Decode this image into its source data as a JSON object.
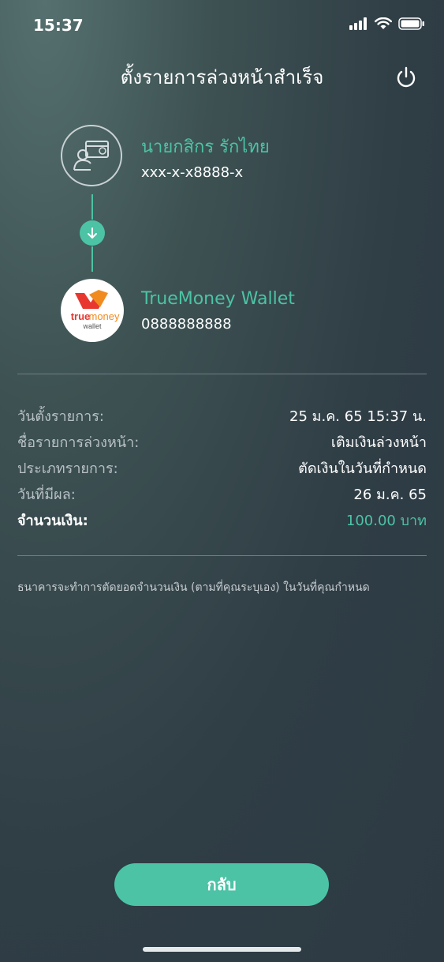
{
  "status": {
    "time": "15:37"
  },
  "header": {
    "title": "ตั้งรายการล่วงหน้าสำเร็จ"
  },
  "from_account": {
    "name": "นายกสิกร รักไทย",
    "number": "xxx-x-x8888-x"
  },
  "to_account": {
    "name": "TrueMoney Wallet",
    "number": "0888888888",
    "logo_text_1": "true",
    "logo_text_2": "money",
    "logo_text_3": "wallet"
  },
  "details": [
    {
      "label": "วันตั้งรายการ:",
      "value": "25 ม.ค. 65  15:37 น."
    },
    {
      "label": "ชื่อรายการล่วงหน้า:",
      "value": "เติมเงินล่วงหน้า"
    },
    {
      "label": "ประเภทรายการ:",
      "value": "ตัดเงินในวันที่กำหนด"
    },
    {
      "label": "วันที่มีผล:",
      "value": "26 ม.ค. 65"
    },
    {
      "label": "จำนวนเงิน:",
      "value": "100.00 บาท"
    }
  ],
  "note": "ธนาคารจะทำการตัดยอดจำนวนเงิน (ตามที่คุณระบุเอง) ในวันที่คุณกำหนด",
  "buttons": {
    "back": "กลับ"
  },
  "colors": {
    "accent": "#4cc3a5",
    "background": "#2d3a44"
  }
}
